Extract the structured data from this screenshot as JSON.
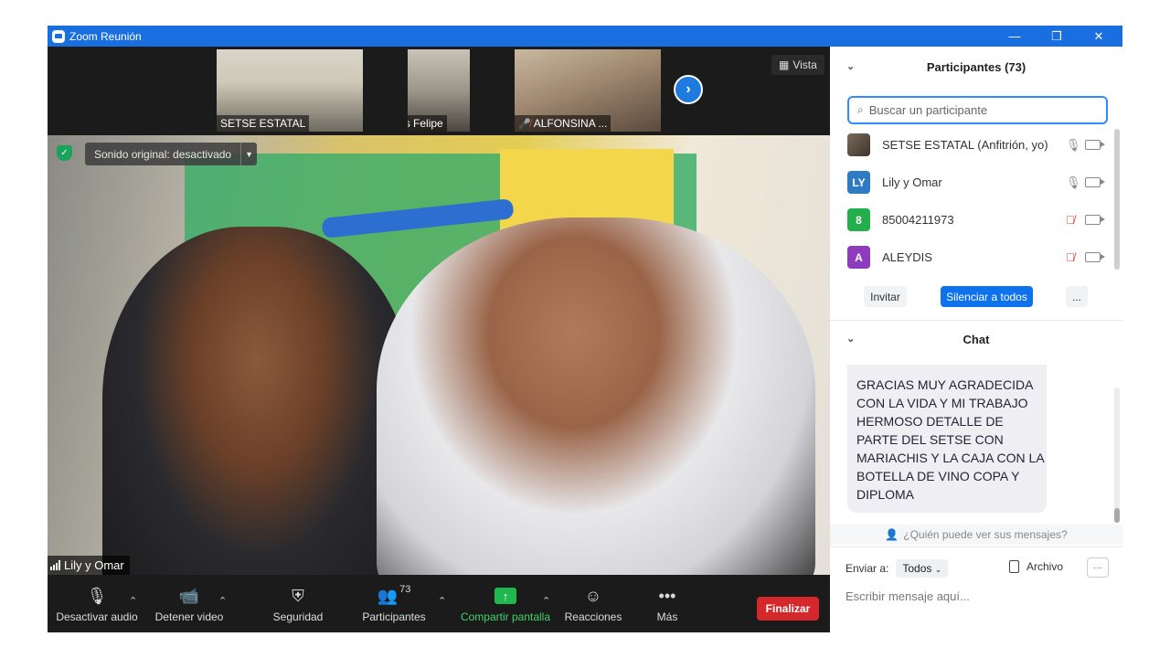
{
  "window": {
    "title": "Zoom Reunión",
    "colors": {
      "titlebar": "#1a6fe0",
      "accent": "#2d8cff",
      "end": "#d5282c",
      "share": "#1fb84e",
      "muted": "#e8453c"
    },
    "controls": {
      "minimize": "—",
      "restore": "❐",
      "close": "✕"
    }
  },
  "thumbnails": [
    {
      "label": "SETSE ESTATAL",
      "muted": false
    },
    {
      "label": "Luis Felipe",
      "muted": true
    },
    {
      "label": "ALFONSINA ...",
      "muted": true
    }
  ],
  "view_button": "Vista",
  "next_icon": "›",
  "main_video": {
    "audio_menu": "Sonido original: desactivado",
    "speaker": "Lily y Omar"
  },
  "toolbar": {
    "mute": "Desactivar audio",
    "video": "Detener video",
    "security": "Seguridad",
    "participants": "Participantes",
    "participants_count": "73",
    "share": "Compartir pantalla",
    "reactions": "Reacciones",
    "more": "Más",
    "end": "Finalizar"
  },
  "participants_panel": {
    "title": "Participantes (73)",
    "search_placeholder": "Buscar un participante",
    "list": [
      {
        "initials": "",
        "name": "SETSE ESTATAL (Anfitrión, yo)",
        "color": "#6b5a4a",
        "mic_muted": false
      },
      {
        "initials": "LY",
        "name": "Lily y Omar",
        "color": "#2e7bc4",
        "mic_muted": false
      },
      {
        "initials": "8",
        "name": "85004211973",
        "color": "#23b04c",
        "mic_muted": true
      },
      {
        "initials": "A",
        "name": "ALEYDIS",
        "color": "#8e3bbd",
        "mic_muted": true
      }
    ],
    "invite": "Invitar",
    "mute_all": "Silenciar a todos",
    "more": "..."
  },
  "chat_panel": {
    "title": "Chat",
    "message": "GRACIAS MUY AGRADECIDA CON LA VIDA Y MI TRABAJO HERMOSO DETALLE DE PARTE DEL SETSE CON MARIACHIS Y LA CAJA CON LA BOTELLA DE VINO COPA Y DIPLOMA",
    "who_sees": "¿Quién puede ver sus mensajes?",
    "send_to_label": "Enviar a:",
    "send_to_value": "Todos",
    "file": "Archivo",
    "more": "···",
    "input_placeholder": "Escribir mensaje aquí..."
  }
}
